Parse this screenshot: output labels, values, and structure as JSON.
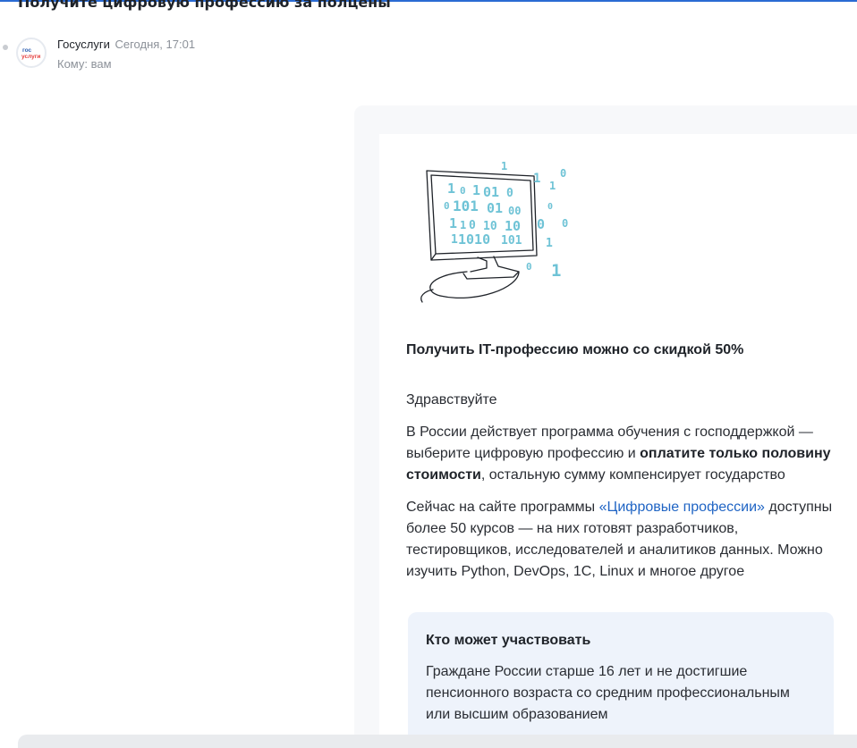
{
  "email": {
    "subject": "Получите цифровую профессию за полцены",
    "sender": {
      "name": "Госуслуги",
      "time": "Сегодня, 17:01",
      "recipient": "Кому: вам",
      "logo_text": [
        "гос",
        "услуги"
      ]
    }
  },
  "body": {
    "illustration_icon": "computer-binary-icon",
    "headline": "Получить IT-профессию можно со скидкой 50%",
    "greeting": "Здравствуйте",
    "program": {
      "text_before": "В России действует программа обучения с господдержкой — выберите цифровую профессию и ",
      "bold": "оплатите только половину стоимости",
      "text_after": ", остальную сумму компенсирует государство"
    },
    "now": {
      "text_before": "Сейчас на сайте программы ",
      "link": "«Цифровые профессии»",
      "text_after": " доступны более 50 курсов — на них готовят разработчиков, тестировщиков, исследователей и аналитиков данных. Можно изучить Python, DevOps, 1C, Linux и многое другое"
    },
    "info": {
      "title": "Кто может участвовать",
      "text": "Граждане России старше 16 лет и не достигшие пенсионного возраста со средним профессиональным или высшим образованием"
    }
  },
  "colors": {
    "accent": "#2a6bd3",
    "link": "#1f64c4",
    "logo_blue": "#2a5db0",
    "logo_red": "#e5403f",
    "binary_digits": "#6fc3d6",
    "info_background": "#eef3fb"
  }
}
